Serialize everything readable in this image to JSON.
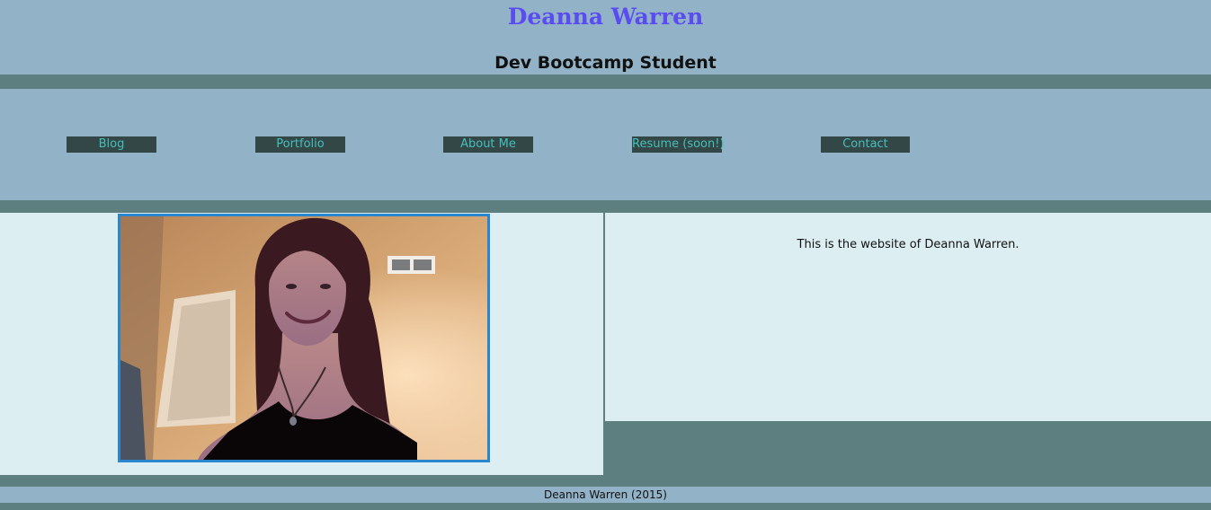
{
  "header": {
    "title": "Deanna Warren",
    "subtitle": "Dev Bootcamp Student"
  },
  "nav": {
    "items": [
      {
        "label": "Blog"
      },
      {
        "label": "Portfolio"
      },
      {
        "label": "About Me"
      },
      {
        "label": "Resume (soon!)"
      },
      {
        "label": "Contact"
      }
    ]
  },
  "main": {
    "photo_icon": "profile-photo",
    "intro_text": "This is the website of Deanna Warren."
  },
  "footer": {
    "text": "Deanna Warren (2015)"
  },
  "colors": {
    "title": "#5a4cf0",
    "header_bg": "#92b2c7",
    "page_bg": "#5e7f80",
    "nav_button_bg": "#324746",
    "nav_button_text": "#46bfbc",
    "content_bg": "#ddeef2",
    "photo_border": "#2a86cf"
  }
}
